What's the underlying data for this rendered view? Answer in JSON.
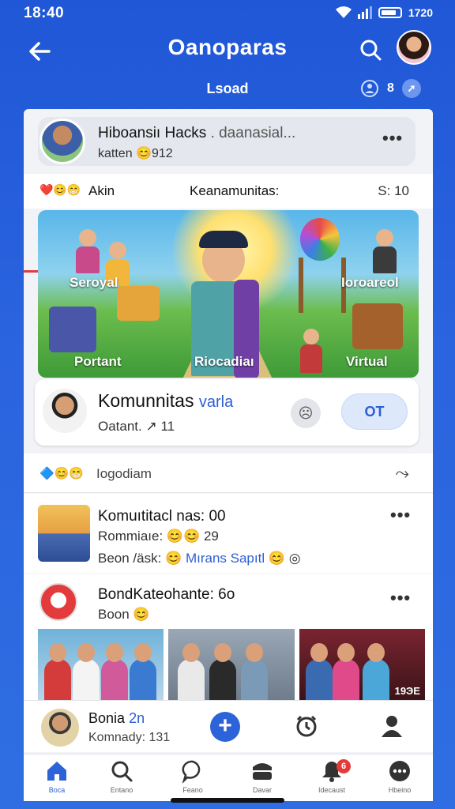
{
  "status": {
    "time": "18:40",
    "battery": "1720"
  },
  "header": {
    "title": "Oanoparas",
    "subtitle": "Lsoad",
    "right_count": "8"
  },
  "profile_card": {
    "name": "Hiboansiı Hacks",
    "name_suffix": ". daanasial...",
    "sub": "katten 😊912"
  },
  "reactions": {
    "emojis": "❤️😊😁",
    "label": "Akin",
    "middle": "Keanamunitas:",
    "right": "S: 10"
  },
  "hero": {
    "labels": {
      "left_top": "Seroyal",
      "right_top": "Ioroareol",
      "left_bottom": "Portant",
      "center_bottom": "Riocadiaı",
      "right_bottom": "Virtual"
    }
  },
  "community": {
    "title": "Komunnitas",
    "title_accent": "varla",
    "sub": "Oatant. ↗ 11",
    "button": "OT"
  },
  "feed": {
    "emojis": "🔷😊😁",
    "label": "Iogodiam"
  },
  "post1": {
    "title": "Komuıtitacl nas: 00",
    "line2": "Rommiaıe: 😊😊 29",
    "line3_prefix": "Beon /äsk: 😊",
    "line3_link": "Mırans Sapıtl",
    "line3_suffix": "😊 ◎"
  },
  "post2": {
    "title": "BondKateohante: 6o",
    "sub": "Boon 😊",
    "photo_label": "19ЭE"
  },
  "bottom_card": {
    "title": "Bonia",
    "title_accent": "2n",
    "sub": "Komnady: 131"
  },
  "nav": {
    "items": [
      {
        "label": "Boca"
      },
      {
        "label": "Entano"
      },
      {
        "label": "Feano"
      },
      {
        "label": "Davar"
      },
      {
        "label": "Idecaust"
      },
      {
        "label": "Hbeino"
      }
    ],
    "badge": "6"
  },
  "colors": {
    "primary": "#2d5fd2",
    "header_bg": "#1f57d6",
    "badge": "#e33b3b"
  }
}
